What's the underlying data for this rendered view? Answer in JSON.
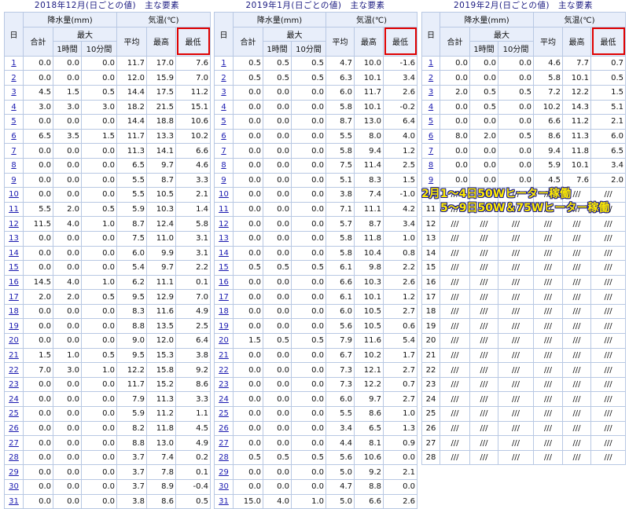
{
  "headers": {
    "day": "日",
    "precip": "降水量(mm)",
    "temp": "気温(℃)",
    "total": "合計",
    "max": "最大",
    "h1": "1時間",
    "m10": "10分間",
    "avg": "平均",
    "tmax": "最高",
    "tmin": "最低"
  },
  "panels": [
    {
      "title": "2018年12月(日ごとの値)　主な要素",
      "rows": [
        {
          "d": "1",
          "c": [
            "0.0",
            "0.0",
            "0.0",
            "11.7",
            "17.0",
            "7.6"
          ]
        },
        {
          "d": "2",
          "c": [
            "0.0",
            "0.0",
            "0.0",
            "12.0",
            "15.9",
            "7.0"
          ]
        },
        {
          "d": "3",
          "c": [
            "4.5",
            "1.5",
            "0.5",
            "14.4",
            "17.5",
            "11.2"
          ]
        },
        {
          "d": "4",
          "c": [
            "3.0",
            "3.0",
            "3.0",
            "18.2",
            "21.5",
            "15.1"
          ]
        },
        {
          "d": "5",
          "c": [
            "0.0",
            "0.0",
            "0.0",
            "14.4",
            "18.8",
            "10.6"
          ]
        },
        {
          "d": "6",
          "c": [
            "6.5",
            "3.5",
            "1.5",
            "11.7",
            "13.3",
            "10.2"
          ]
        },
        {
          "d": "7",
          "c": [
            "0.0",
            "0.0",
            "0.0",
            "11.3",
            "14.1",
            "6.6"
          ]
        },
        {
          "d": "8",
          "c": [
            "0.0",
            "0.0",
            "0.0",
            "6.5",
            "9.7",
            "4.6"
          ]
        },
        {
          "d": "9",
          "c": [
            "0.0",
            "0.0",
            "0.0",
            "5.5",
            "8.7",
            "3.3"
          ]
        },
        {
          "d": "10",
          "c": [
            "0.0",
            "0.0",
            "0.0",
            "5.5",
            "10.5",
            "2.1"
          ]
        },
        {
          "d": "11",
          "c": [
            "5.5",
            "2.0",
            "0.5",
            "5.9",
            "10.3",
            "1.4"
          ]
        },
        {
          "d": "12",
          "c": [
            "11.5",
            "4.0",
            "1.0",
            "8.7",
            "12.4",
            "5.8"
          ]
        },
        {
          "d": "13",
          "c": [
            "0.0",
            "0.0",
            "0.0",
            "7.5",
            "11.0",
            "3.1"
          ]
        },
        {
          "d": "14",
          "c": [
            "0.0",
            "0.0",
            "0.0",
            "6.0",
            "9.9",
            "3.1"
          ]
        },
        {
          "d": "15",
          "c": [
            "0.0",
            "0.0",
            "0.0",
            "5.4",
            "9.7",
            "2.2"
          ]
        },
        {
          "d": "16",
          "c": [
            "14.5",
            "4.0",
            "1.0",
            "6.2",
            "11.1",
            "0.1"
          ]
        },
        {
          "d": "17",
          "c": [
            "2.0",
            "2.0",
            "0.5",
            "9.5",
            "12.9",
            "7.0"
          ]
        },
        {
          "d": "18",
          "c": [
            "0.0",
            "0.0",
            "0.0",
            "8.3",
            "11.6",
            "4.9"
          ]
        },
        {
          "d": "19",
          "c": [
            "0.0",
            "0.0",
            "0.0",
            "8.8",
            "13.5",
            "2.5"
          ]
        },
        {
          "d": "20",
          "c": [
            "0.0",
            "0.0",
            "0.0",
            "9.0",
            "12.0",
            "6.4"
          ]
        },
        {
          "d": "21",
          "c": [
            "1.5",
            "1.0",
            "0.5",
            "9.5",
            "15.3",
            "3.8"
          ]
        },
        {
          "d": "22",
          "c": [
            "7.0",
            "3.0",
            "1.0",
            "12.2",
            "15.8",
            "9.2"
          ]
        },
        {
          "d": "23",
          "c": [
            "0.0",
            "0.0",
            "0.0",
            "11.7",
            "15.2",
            "8.6"
          ]
        },
        {
          "d": "24",
          "c": [
            "0.0",
            "0.0",
            "0.0",
            "7.9",
            "11.3",
            "3.3"
          ]
        },
        {
          "d": "25",
          "c": [
            "0.0",
            "0.0",
            "0.0",
            "5.9",
            "11.2",
            "1.1"
          ]
        },
        {
          "d": "26",
          "c": [
            "0.0",
            "0.0",
            "0.0",
            "8.2",
            "11.8",
            "4.5"
          ]
        },
        {
          "d": "27",
          "c": [
            "0.0",
            "0.0",
            "0.0",
            "8.8",
            "13.0",
            "4.9"
          ]
        },
        {
          "d": "28",
          "c": [
            "0.0",
            "0.0",
            "0.0",
            "3.7",
            "7.4",
            "0.2"
          ]
        },
        {
          "d": "29",
          "c": [
            "0.0",
            "0.0",
            "0.0",
            "3.7",
            "7.8",
            "0.1"
          ]
        },
        {
          "d": "30",
          "c": [
            "0.0",
            "0.0",
            "0.0",
            "3.7",
            "8.9",
            "-0.4"
          ]
        },
        {
          "d": "31",
          "c": [
            "0.0",
            "0.0",
            "0.0",
            "3.8",
            "8.6",
            "0.5"
          ]
        }
      ]
    },
    {
      "title": "2019年1月(日ごとの値)　主な要素",
      "rows": [
        {
          "d": "1",
          "c": [
            "0.5",
            "0.5",
            "0.5",
            "4.7",
            "10.0",
            "-1.6"
          ]
        },
        {
          "d": "2",
          "c": [
            "0.5",
            "0.5",
            "0.5",
            "6.3",
            "10.1",
            "3.4"
          ]
        },
        {
          "d": "3",
          "c": [
            "0.0",
            "0.0",
            "0.0",
            "6.0",
            "11.7",
            "2.6"
          ]
        },
        {
          "d": "4",
          "c": [
            "0.0",
            "0.0",
            "0.0",
            "5.8",
            "10.1",
            "-0.2"
          ]
        },
        {
          "d": "5",
          "c": [
            "0.0",
            "0.0",
            "0.0",
            "8.7",
            "13.0",
            "6.4"
          ]
        },
        {
          "d": "6",
          "c": [
            "0.0",
            "0.0",
            "0.0",
            "5.5",
            "8.0",
            "4.0"
          ]
        },
        {
          "d": "7",
          "c": [
            "0.0",
            "0.0",
            "0.0",
            "5.8",
            "9.4",
            "1.2"
          ]
        },
        {
          "d": "8",
          "c": [
            "0.0",
            "0.0",
            "0.0",
            "7.5",
            "11.4",
            "2.5"
          ]
        },
        {
          "d": "9",
          "c": [
            "0.0",
            "0.0",
            "0.0",
            "5.1",
            "8.3",
            "1.5"
          ]
        },
        {
          "d": "10",
          "c": [
            "0.0",
            "0.0",
            "0.0",
            "3.8",
            "7.4",
            "-1.0"
          ]
        },
        {
          "d": "11",
          "c": [
            "0.0",
            "0.0",
            "0.0",
            "7.1",
            "11.1",
            "4.2"
          ]
        },
        {
          "d": "12",
          "c": [
            "0.0",
            "0.0",
            "0.0",
            "5.7",
            "8.7",
            "3.4"
          ]
        },
        {
          "d": "13",
          "c": [
            "0.0",
            "0.0",
            "0.0",
            "5.8",
            "11.8",
            "1.0"
          ]
        },
        {
          "d": "14",
          "c": [
            "0.0",
            "0.0",
            "0.0",
            "5.8",
            "10.4",
            "0.8"
          ]
        },
        {
          "d": "15",
          "c": [
            "0.5",
            "0.5",
            "0.5",
            "6.1",
            "9.8",
            "2.2"
          ]
        },
        {
          "d": "16",
          "c": [
            "0.0",
            "0.0",
            "0.0",
            "6.6",
            "10.3",
            "2.6"
          ]
        },
        {
          "d": "17",
          "c": [
            "0.0",
            "0.0",
            "0.0",
            "6.1",
            "10.1",
            "1.2"
          ]
        },
        {
          "d": "18",
          "c": [
            "0.0",
            "0.0",
            "0.0",
            "6.0",
            "10.5",
            "2.7"
          ]
        },
        {
          "d": "19",
          "c": [
            "0.0",
            "0.0",
            "0.0",
            "5.6",
            "10.5",
            "0.6"
          ]
        },
        {
          "d": "20",
          "c": [
            "1.5",
            "0.5",
            "0.5",
            "7.9",
            "11.6",
            "5.4"
          ]
        },
        {
          "d": "21",
          "c": [
            "0.0",
            "0.0",
            "0.0",
            "6.7",
            "10.2",
            "1.7"
          ]
        },
        {
          "d": "22",
          "c": [
            "0.0",
            "0.0",
            "0.0",
            "7.3",
            "12.1",
            "2.7"
          ]
        },
        {
          "d": "23",
          "c": [
            "0.0",
            "0.0",
            "0.0",
            "7.3",
            "12.2",
            "0.7"
          ]
        },
        {
          "d": "24",
          "c": [
            "0.0",
            "0.0",
            "0.0",
            "6.0",
            "9.7",
            "2.7"
          ]
        },
        {
          "d": "25",
          "c": [
            "0.0",
            "0.0",
            "0.0",
            "5.5",
            "8.6",
            "1.0"
          ]
        },
        {
          "d": "26",
          "c": [
            "0.0",
            "0.0",
            "0.0",
            "3.4",
            "6.5",
            "1.3"
          ]
        },
        {
          "d": "27",
          "c": [
            "0.0",
            "0.0",
            "0.0",
            "4.4",
            "8.1",
            "0.9"
          ]
        },
        {
          "d": "28",
          "c": [
            "0.5",
            "0.5",
            "0.5",
            "5.6",
            "10.6",
            "0.0"
          ]
        },
        {
          "d": "29",
          "c": [
            "0.0",
            "0.0",
            "0.0",
            "5.0",
            "9.2",
            "2.1"
          ]
        },
        {
          "d": "30",
          "c": [
            "0.0",
            "0.0",
            "0.0",
            "4.7",
            "8.8",
            "0.0"
          ]
        },
        {
          "d": "31",
          "c": [
            "15.0",
            "4.0",
            "1.0",
            "5.0",
            "6.6",
            "2.6"
          ]
        }
      ]
    },
    {
      "title": "2019年2月(日ごとの値)　主な要素",
      "rows": [
        {
          "d": "1",
          "c": [
            "0.0",
            "0.0",
            "0.0",
            "4.6",
            "7.7",
            "0.7"
          ]
        },
        {
          "d": "2",
          "c": [
            "0.0",
            "0.0",
            "0.0",
            "5.8",
            "10.1",
            "0.5"
          ]
        },
        {
          "d": "3",
          "c": [
            "2.0",
            "0.5",
            "0.5",
            "7.2",
            "12.2",
            "1.5"
          ]
        },
        {
          "d": "4",
          "c": [
            "0.0",
            "0.5",
            "0.0",
            "10.2",
            "14.3",
            "5.1"
          ]
        },
        {
          "d": "5",
          "c": [
            "0.0",
            "0.0",
            "0.0",
            "6.6",
            "11.2",
            "2.1"
          ]
        },
        {
          "d": "6",
          "c": [
            "8.0",
            "2.0",
            "0.5",
            "8.6",
            "11.3",
            "6.0"
          ]
        },
        {
          "d": "7",
          "c": [
            "0.0",
            "0.0",
            "0.0",
            "9.4",
            "11.8",
            "6.5"
          ]
        },
        {
          "d": "8",
          "c": [
            "0.0",
            "0.0",
            "0.0",
            "5.9",
            "10.1",
            "3.4"
          ]
        },
        {
          "d": "9",
          "c": [
            "0.0",
            "0.0",
            "0.0",
            "4.5",
            "7.6",
            "2.0"
          ]
        },
        {
          "d": "10",
          "c": [
            "///",
            "///",
            "///",
            "///",
            "///",
            "///"
          ]
        },
        {
          "d": "11",
          "c": [
            "///",
            "///",
            "///",
            "///",
            "///",
            "///"
          ]
        },
        {
          "d": "12",
          "c": [
            "///",
            "///",
            "///",
            "///",
            "///",
            "///"
          ]
        },
        {
          "d": "13",
          "c": [
            "///",
            "///",
            "///",
            "///",
            "///",
            "///"
          ]
        },
        {
          "d": "14",
          "c": [
            "///",
            "///",
            "///",
            "///",
            "///",
            "///"
          ]
        },
        {
          "d": "15",
          "c": [
            "///",
            "///",
            "///",
            "///",
            "///",
            "///"
          ]
        },
        {
          "d": "16",
          "c": [
            "///",
            "///",
            "///",
            "///",
            "///",
            "///"
          ]
        },
        {
          "d": "17",
          "c": [
            "///",
            "///",
            "///",
            "///",
            "///",
            "///"
          ]
        },
        {
          "d": "18",
          "c": [
            "///",
            "///",
            "///",
            "///",
            "///",
            "///"
          ]
        },
        {
          "d": "19",
          "c": [
            "///",
            "///",
            "///",
            "///",
            "///",
            "///"
          ]
        },
        {
          "d": "20",
          "c": [
            "///",
            "///",
            "///",
            "///",
            "///",
            "///"
          ]
        },
        {
          "d": "21",
          "c": [
            "///",
            "///",
            "///",
            "///",
            "///",
            "///"
          ]
        },
        {
          "d": "22",
          "c": [
            "///",
            "///",
            "///",
            "///",
            "///",
            "///"
          ]
        },
        {
          "d": "23",
          "c": [
            "///",
            "///",
            "///",
            "///",
            "///",
            "///"
          ]
        },
        {
          "d": "24",
          "c": [
            "///",
            "///",
            "///",
            "///",
            "///",
            "///"
          ]
        },
        {
          "d": "25",
          "c": [
            "///",
            "///",
            "///",
            "///",
            "///",
            "///"
          ]
        },
        {
          "d": "26",
          "c": [
            "///",
            "///",
            "///",
            "///",
            "///",
            "///"
          ]
        },
        {
          "d": "27",
          "c": [
            "///",
            "///",
            "///",
            "///",
            "///",
            "///"
          ]
        },
        {
          "d": "28",
          "c": [
            "///",
            "///",
            "///",
            "///",
            "///",
            "///"
          ]
        }
      ]
    }
  ],
  "annotation": {
    "line1": "2月1〜4日50Wヒーター稼働",
    "line2": "5〜9日50W＆75Wヒーター稼働"
  },
  "colors": {
    "link": "#1a1ab0",
    "header_bg": "#e8eefa",
    "grid": "#b8c8e3",
    "highlight": "#e00000",
    "annotation_fill": "#ffeb00",
    "annotation_stroke": "#1c1c8c"
  }
}
